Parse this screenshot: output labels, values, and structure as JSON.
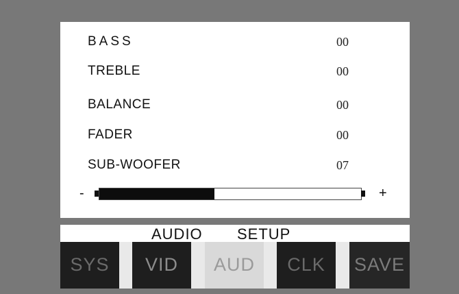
{
  "menu": {
    "items": [
      {
        "label": "BASS",
        "value": "00"
      },
      {
        "label": "TREBLE",
        "value": "00"
      },
      {
        "label": "BALANCE",
        "value": "00"
      },
      {
        "label": "FADER",
        "value": "00"
      },
      {
        "label": "SUB-WOOFER",
        "value": "07"
      }
    ]
  },
  "slider": {
    "minus_label": "-",
    "plus_label": "+",
    "level_fraction": 0.44
  },
  "header": {
    "title_word1": "AUDIO",
    "title_word2": "SETUP"
  },
  "tabs": [
    {
      "label": "SYS",
      "active": false
    },
    {
      "label": "VID",
      "active": false
    },
    {
      "label": "AUD",
      "active": true
    },
    {
      "label": "CLK",
      "active": false
    },
    {
      "label": "SAVE",
      "active": false
    }
  ],
  "colors": {
    "background": "#787878",
    "panel": "#ffffff",
    "tab_inactive": "#1e1e1e",
    "tab_active": "#d9d9d9",
    "slider_fill": "#0d0d0d"
  }
}
